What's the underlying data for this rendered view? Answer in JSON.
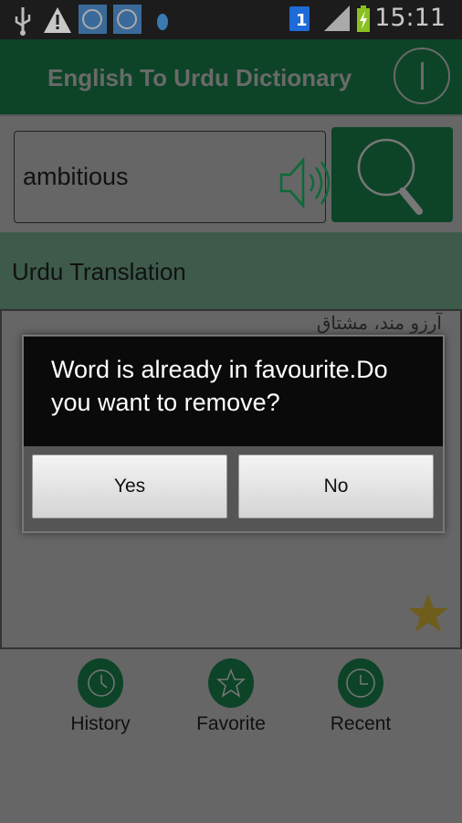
{
  "status_bar": {
    "time": "15:11",
    "icons": [
      "usb-icon",
      "warning-icon",
      "m-app-icon",
      "m-app-icon",
      "footprint-icon",
      "sim-1-icon",
      "signal-icon",
      "battery-charging-icon"
    ]
  },
  "header": {
    "title": "English To Urdu Dictionary",
    "info_icon": "info-icon"
  },
  "search": {
    "value": "ambitious"
  },
  "translation": {
    "label": "Urdu Translation",
    "text": "آرزو مند، مشتاق"
  },
  "nav": [
    {
      "label": "History",
      "icon": "history-icon"
    },
    {
      "label": "Favorite",
      "icon": "star-icon"
    },
    {
      "label": "Recent",
      "icon": "clock-icon"
    }
  ],
  "dialog": {
    "message": "Word is already in favourite.Do you want to remove?",
    "yes": "Yes",
    "no": "No"
  },
  "colors": {
    "header": "#0d4428",
    "band": "#3d5a4a",
    "star": "#6e5d1c",
    "overlay_bg": "#666666"
  }
}
